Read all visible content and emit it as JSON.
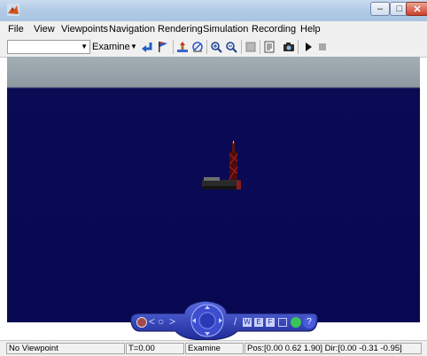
{
  "window": {
    "title": "",
    "buttons": {
      "minimize": "–",
      "maximize": "□",
      "close": "✕"
    }
  },
  "menu": [
    "File",
    "View",
    "Viewpoints",
    "Navigation",
    "Rendering",
    "Simulation",
    "Recording",
    "Help"
  ],
  "toolbar": {
    "viewpoint_value": "",
    "mode_value": "Examine"
  },
  "nav_panel": {
    "buttons": [
      "W",
      "E",
      "F"
    ],
    "help_label": "?"
  },
  "status": {
    "viewpoint": "No Viewpoint",
    "time": "T=0.00",
    "mode": "Examine",
    "position": "Pos:[0.00 0.62 1.90] Dir:[0.00 -0.31 -0.95]"
  },
  "colors": {
    "sky": "#0a0a55",
    "ground": "#8e9aa1",
    "nav_panel": "#2c3cb0",
    "accent_red": "#c0392b"
  },
  "icons": [
    "matlab-icon",
    "undo-arrow-icon",
    "flag-icon",
    "straighten-icon",
    "zoom-fit-icon",
    "zoom-in-icon",
    "zoom-out-icon",
    "wireframe-icon",
    "page-icon",
    "camera-icon",
    "play-icon",
    "stop-icon"
  ]
}
